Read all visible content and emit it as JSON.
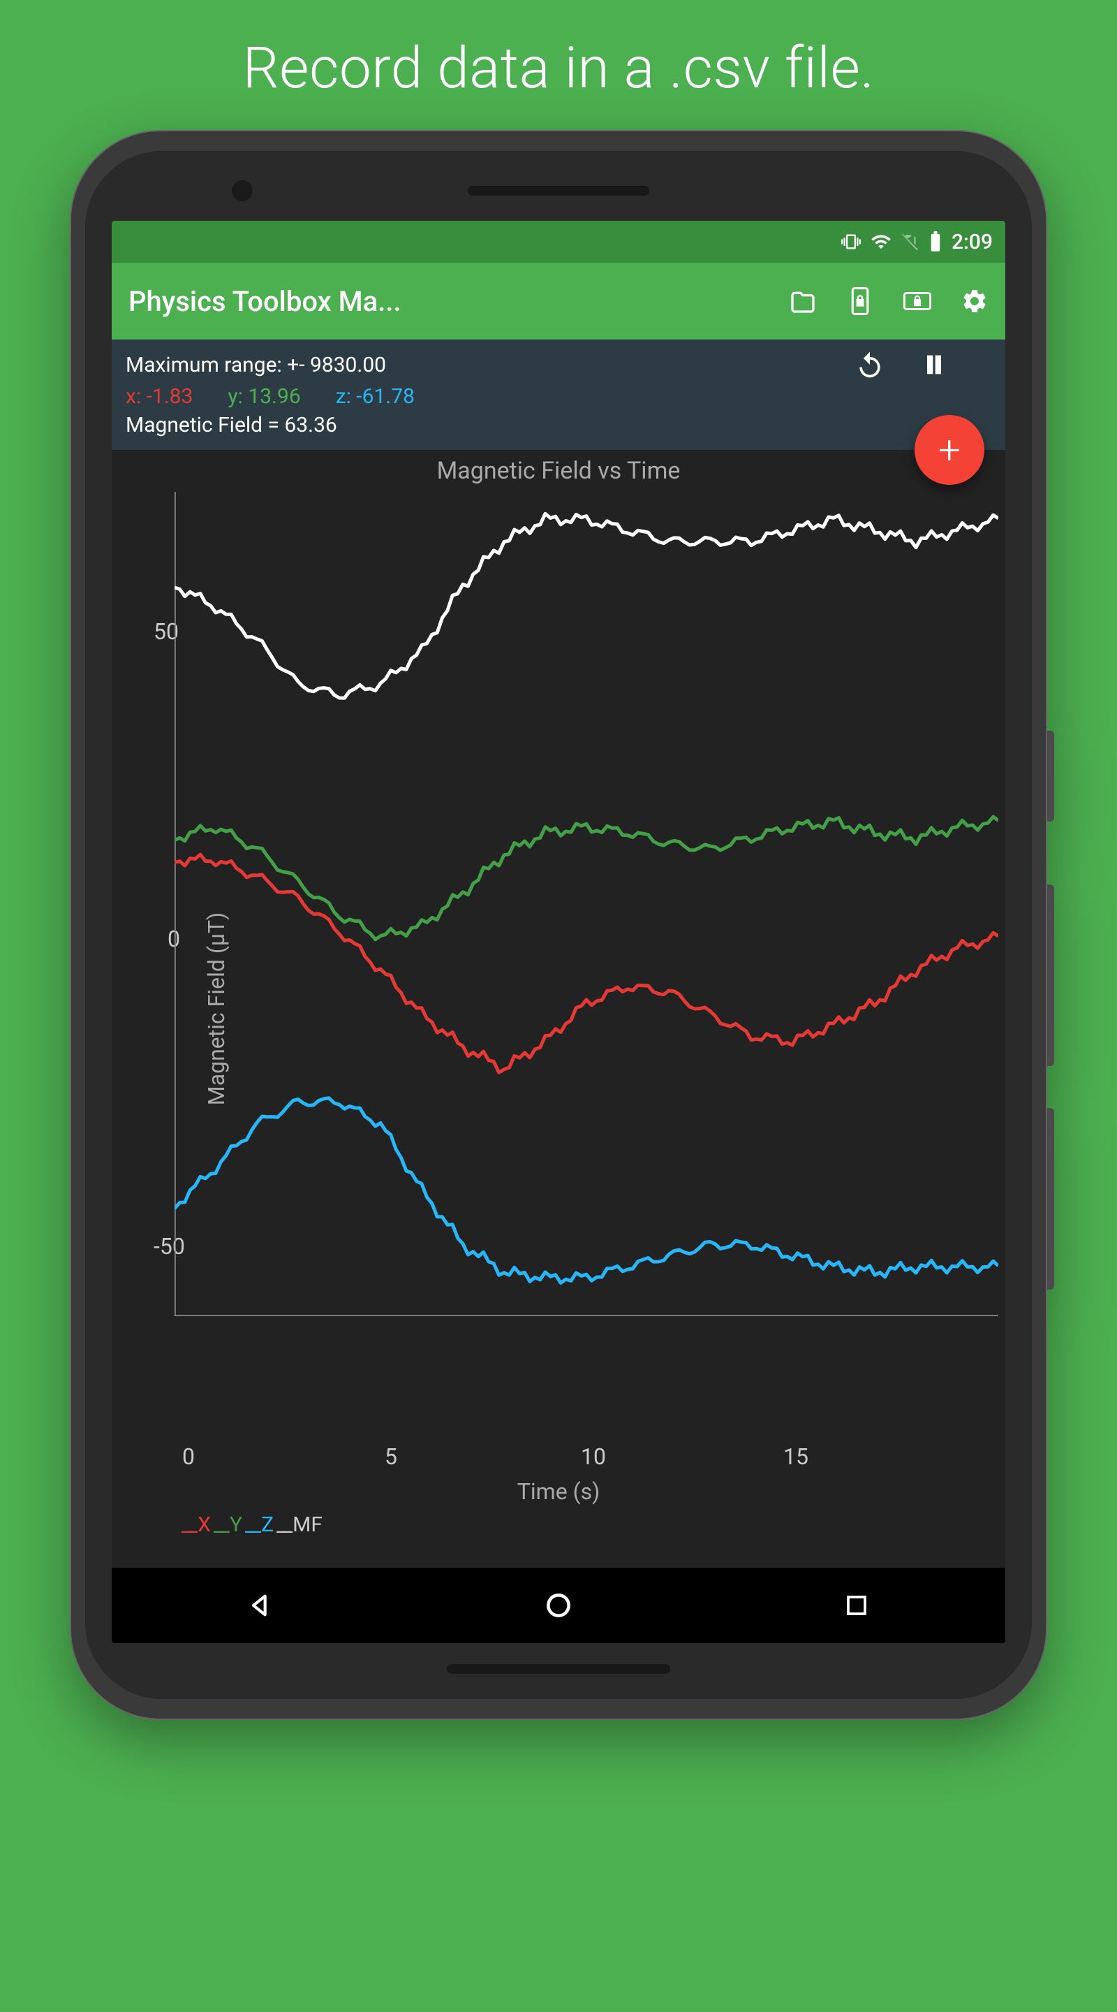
{
  "headline": "Record data in a .csv file.",
  "statusbar": {
    "time": "2:09"
  },
  "appbar": {
    "title": "Physics Toolbox Ma..."
  },
  "info": {
    "range_label": "Maximum range: +- 9830.00",
    "x_label": "x:",
    "x_val": "-1.83",
    "y_label": "y:",
    "y_val": "13.96",
    "z_label": "z:",
    "z_val": "-61.78",
    "mf_label": "Magnetic Field  =  63.36"
  },
  "fab": {
    "label": "+"
  },
  "chart": {
    "title": "Magnetic Field vs Time",
    "ylabel": "Magnetic Field (µT)",
    "xlabel": "Time (s)",
    "legend": {
      "x": "X",
      "y": "Y",
      "z": "Z",
      "mf": "MF"
    },
    "yticks": [
      "50",
      "0",
      "-50"
    ],
    "xticks": [
      "0",
      "5",
      "10",
      "15"
    ]
  },
  "chart_data": {
    "type": "line",
    "title": "Magnetic Field vs Time",
    "xlabel": "Time (s)",
    "ylabel": "Magnetic Field (µT)",
    "xlim": [
      0,
      20
    ],
    "ylim": [
      -75,
      75
    ],
    "x": [
      0,
      1,
      2,
      3,
      4,
      5,
      6,
      7,
      8,
      9,
      10,
      11,
      12,
      13,
      14,
      15,
      16,
      17,
      18,
      19,
      20
    ],
    "series": [
      {
        "name": "X",
        "color": "#e53935",
        "values": [
          8,
          8,
          5,
          1,
          -5,
          -12,
          -20,
          -26,
          -30,
          -25,
          -18,
          -15,
          -16,
          -20,
          -24,
          -25,
          -22,
          -18,
          -12,
          -8,
          -6
        ]
      },
      {
        "name": "Y",
        "color": "#43a047",
        "values": [
          12,
          14,
          10,
          4,
          -2,
          -6,
          -4,
          2,
          9,
          13,
          14,
          13,
          11,
          10,
          12,
          14,
          15,
          13,
          12,
          14,
          15
        ]
      },
      {
        "name": "Z",
        "color": "#29b6f6",
        "values": [
          -55,
          -48,
          -40,
          -36,
          -36,
          -40,
          -52,
          -62,
          -67,
          -68,
          -68,
          -66,
          -64,
          -62,
          -62,
          -64,
          -66,
          -67,
          -66,
          -66,
          -66
        ]
      },
      {
        "name": "MF",
        "color": "#ffffff",
        "values": [
          58,
          54,
          48,
          40,
          38,
          40,
          46,
          58,
          66,
          70,
          70,
          68,
          66,
          66,
          66,
          68,
          70,
          68,
          66,
          68,
          70
        ]
      }
    ]
  }
}
